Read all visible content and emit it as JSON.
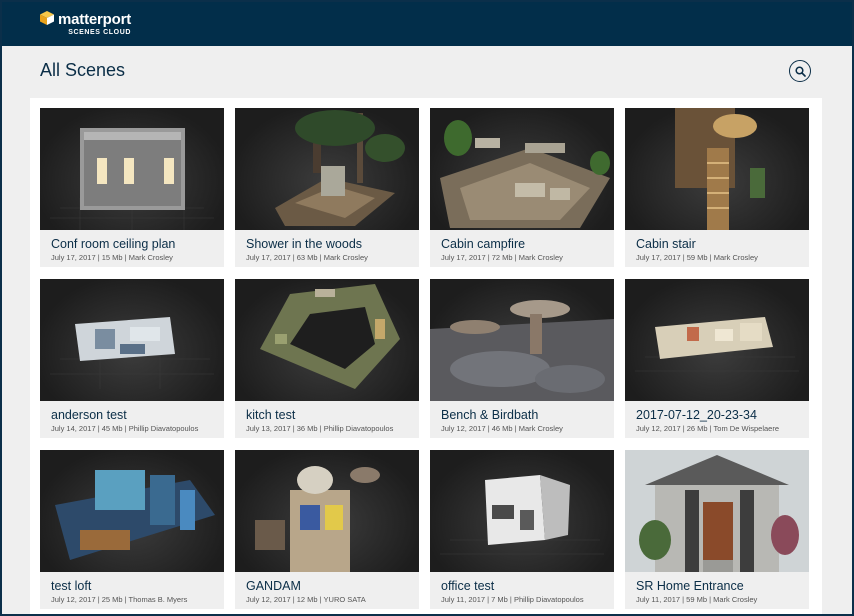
{
  "brand": {
    "name": "matterport",
    "sub": "SCENES CLOUD"
  },
  "page": {
    "title": "All Scenes"
  },
  "icons": {
    "search": "search-icon",
    "logo": "logo-cube-icon"
  },
  "colors": {
    "topbar": "#022e4a",
    "accent": "#0b2e47",
    "background": "#efefef"
  },
  "scenes": [
    {
      "title": "Conf room ceiling plan",
      "meta": "July 17, 2017  |  15 Mb  |  Mark Crosley"
    },
    {
      "title": "Shower in the woods",
      "meta": "July 17, 2017  |  63 Mb  |  Mark Crosley"
    },
    {
      "title": "Cabin campfire",
      "meta": "July 17, 2017  |  72 Mb  |  Mark Crosley"
    },
    {
      "title": "Cabin stair",
      "meta": "July 17, 2017  |  59 Mb  |  Mark Crosley"
    },
    {
      "title": "anderson test",
      "meta": "July 14, 2017  |  45 Mb  |  Phillip Diavatopoulos"
    },
    {
      "title": "kitch test",
      "meta": "July 13, 2017  |  36 Mb  |  Phillip Diavatopoulos"
    },
    {
      "title": "Bench & Birdbath",
      "meta": "July 12, 2017  |  46 Mb  |  Mark Crosley"
    },
    {
      "title": "2017-07-12_20-23-34",
      "meta": "July 12, 2017  |  26 Mb  |  Tom De Wispelaere"
    },
    {
      "title": "test loft",
      "meta": "July 12, 2017  |  25 Mb  |  Thomas B. Myers"
    },
    {
      "title": "GANDAM",
      "meta": "July 12, 2017  |  12 Mb  |  YURO SATA"
    },
    {
      "title": "office test",
      "meta": "July 11, 2017  |  7 Mb  |  Phillip Diavatopoulos"
    },
    {
      "title": "SR Home Entrance",
      "meta": "July 11, 2017  |  59 Mb  |  Mark Crosley"
    }
  ]
}
